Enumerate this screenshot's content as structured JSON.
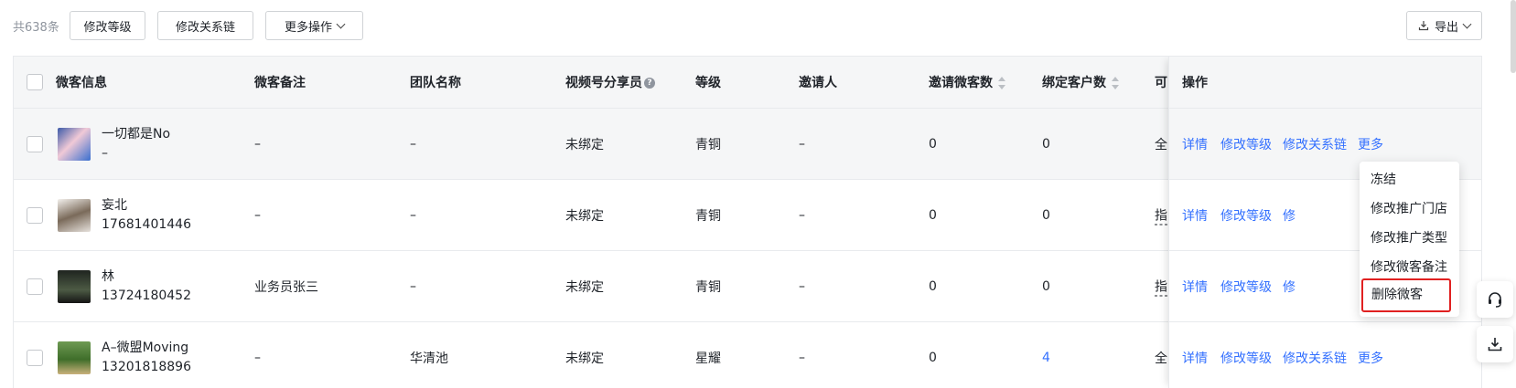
{
  "toolbar": {
    "total": "共638条",
    "btn_level": "修改等级",
    "btn_chain": "修改关系链",
    "btn_more": "更多操作",
    "btn_export": "导出"
  },
  "columns": {
    "info": "微客信息",
    "remark": "微客备注",
    "team": "团队名称",
    "video": "视频号分享员",
    "level": "等级",
    "inviter": "邀请人",
    "invite_count": "邀请微客数",
    "bind_count": "绑定客户数",
    "visible": "可",
    "ops": "操作"
  },
  "rows": [
    {
      "name": "一切都是No",
      "phone": "–",
      "remark": "–",
      "team": "–",
      "video": "未绑定",
      "level": "青铜",
      "inviter": "–",
      "invite_count": "0",
      "bind_count": "0",
      "visible": "全",
      "op1": "详情",
      "op2": "修改等级",
      "op3": "修改关系链",
      "op4": "更多"
    },
    {
      "name": "妄北",
      "phone": "17681401446",
      "remark": "–",
      "team": "–",
      "video": "未绑定",
      "level": "青铜",
      "inviter": "–",
      "invite_count": "0",
      "bind_count": "0",
      "visible": "指",
      "op1": "详情",
      "op2": "修改等级",
      "op3": "修",
      "op4": ""
    },
    {
      "name": "林",
      "phone": "13724180452",
      "remark": "业务员张三",
      "team": "–",
      "video": "未绑定",
      "level": "青铜",
      "inviter": "–",
      "invite_count": "0",
      "bind_count": "0",
      "visible": "指",
      "op1": "详情",
      "op2": "修改等级",
      "op3": "修",
      "op4": ""
    },
    {
      "name": "A–微盟Moving",
      "phone": "13201818896",
      "remark": "–",
      "team": "华清池",
      "video": "未绑定",
      "level": "星耀",
      "inviter": "–",
      "invite_count": "0",
      "bind_count": "4",
      "visible": "全",
      "op1": "详情",
      "op2": "修改等级",
      "op3": "修改关系链",
      "op4": "更多"
    }
  ],
  "dropdown": [
    "冻结",
    "修改推广门店",
    "修改推广类型",
    "修改微客备注",
    "删除微客"
  ],
  "colors": {
    "link": "#3370ff",
    "highlight": "#e02020"
  }
}
